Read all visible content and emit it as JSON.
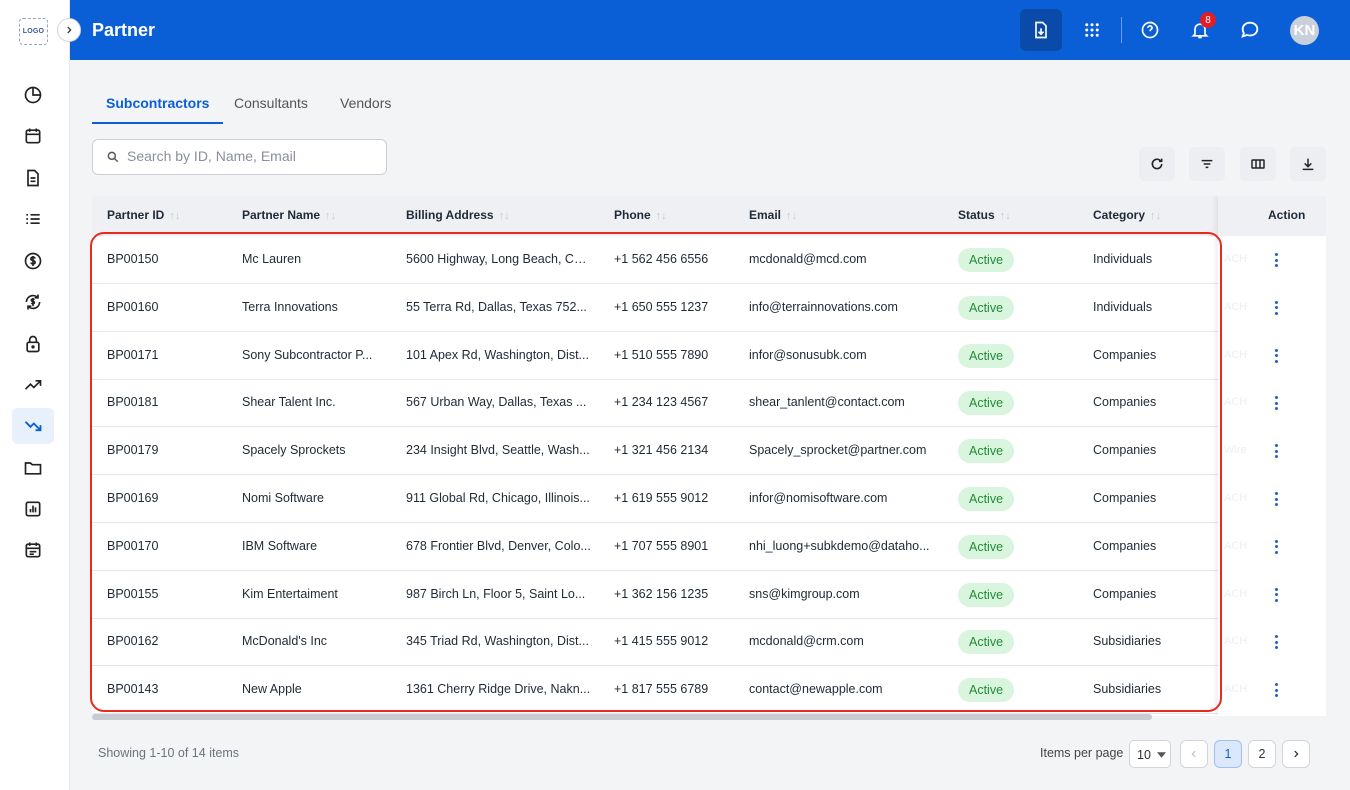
{
  "app": {
    "logo": "LOGO",
    "title": "Partner",
    "user_initials": "KN",
    "notification_count": "8"
  },
  "sidebar": {
    "items": [
      {
        "name": "dashboard-icon"
      },
      {
        "name": "calendar-icon"
      },
      {
        "name": "document-icon"
      },
      {
        "name": "list-icon"
      },
      {
        "name": "dollar-icon"
      },
      {
        "name": "currency-exchange-icon"
      },
      {
        "name": "lock-icon"
      },
      {
        "name": "trending-up-icon"
      },
      {
        "name": "trending-down-icon",
        "active": true
      },
      {
        "name": "folder-icon"
      },
      {
        "name": "bar-chart-icon"
      },
      {
        "name": "event-note-icon"
      }
    ]
  },
  "tabs": [
    {
      "label": "Subcontractors",
      "active": true
    },
    {
      "label": "Consultants"
    },
    {
      "label": "Vendors"
    }
  ],
  "search": {
    "placeholder": "Search by ID, Name, Email",
    "value": ""
  },
  "table": {
    "columns": {
      "id": "Partner ID",
      "name": "Partner Name",
      "address": "Billing Address",
      "phone": "Phone",
      "email": "Email",
      "status": "Status",
      "category": "Category",
      "action": "Action"
    },
    "rows": [
      {
        "id": "BP00150",
        "name": "Mc Lauren",
        "address": "5600 Highway, Long Beach, Ca...",
        "phone": "+1 562 456 6556",
        "email": "mcdonald@mcd.com",
        "status": "Active",
        "category": "Individuals",
        "ghost": "ACH"
      },
      {
        "id": "BP00160",
        "name": "Terra Innovations",
        "address": "55 Terra Rd, Dallas, Texas 752...",
        "phone": "+1 650 555 1237",
        "email": "info@terrainnovations.com",
        "status": "Active",
        "category": "Individuals",
        "ghost": "ACH"
      },
      {
        "id": "BP00171",
        "name": "Sony Subcontractor P...",
        "address": "101 Apex Rd, Washington, Dist...",
        "phone": "+1 510 555 7890",
        "email": "infor@sonusubk.com",
        "status": "Active",
        "category": "Companies",
        "ghost": "ACH"
      },
      {
        "id": "BP00181",
        "name": "Shear Talent Inc.",
        "address": "567 Urban Way, Dallas, Texas ...",
        "phone": "+1 234 123 4567",
        "email": "shear_tanlent@contact.com",
        "status": "Active",
        "category": "Companies",
        "ghost": "ACH"
      },
      {
        "id": "BP00179",
        "name": "Spacely Sprockets",
        "address": "234 Insight Blvd, Seattle, Wash...",
        "phone": "+1 321 456 2134",
        "email": "Spacely_sprocket@partner.com",
        "status": "Active",
        "category": "Companies",
        "ghost": "Wire"
      },
      {
        "id": "BP00169",
        "name": "Nomi Software",
        "address": "911 Global Rd, Chicago, Illinois...",
        "phone": "+1 619 555 9012",
        "email": "infor@nomisoftware.com",
        "status": "Active",
        "category": "Companies",
        "ghost": "ACH"
      },
      {
        "id": "BP00170",
        "name": "IBM Software",
        "address": "678 Frontier Blvd, Denver, Colo...",
        "phone": "+1 707 555 8901",
        "email": "nhi_luong+subkdemo@dataho...",
        "status": "Active",
        "category": "Companies",
        "ghost": "ACH"
      },
      {
        "id": "BP00155",
        "name": "Kim Entertaiment",
        "address": "987 Birch Ln, Floor 5, Saint Lo...",
        "phone": "+1 362 156 1235",
        "email": "sns@kimgroup.com",
        "status": "Active",
        "category": "Companies",
        "ghost": "ACH"
      },
      {
        "id": "BP00162",
        "name": "McDonald's Inc",
        "address": "345 Triad Rd, Washington, Dist...",
        "phone": "+1 415 555 9012",
        "email": "mcdonald@crm.com",
        "status": "Active",
        "category": "Subsidiaries",
        "ghost": "ACH"
      },
      {
        "id": "BP00143",
        "name": "New Apple",
        "address": "1361 Cherry Ridge Drive, Nakn...",
        "phone": "+1 817 555 6789",
        "email": "contact@newapple.com",
        "status": "Active",
        "category": "Subsidiaries",
        "ghost": "ACH"
      }
    ]
  },
  "footer": {
    "showing": "Showing 1-10 of 14 items",
    "items_per_page_label": "Items per page",
    "items_per_page": "10",
    "pages": [
      "1",
      "2"
    ],
    "current_page": "1"
  },
  "colors": {
    "primary": "#0b5fd6",
    "active_status_bg": "#d9f5de",
    "active_status_text": "#238a36",
    "highlight": "#e82a1f"
  }
}
